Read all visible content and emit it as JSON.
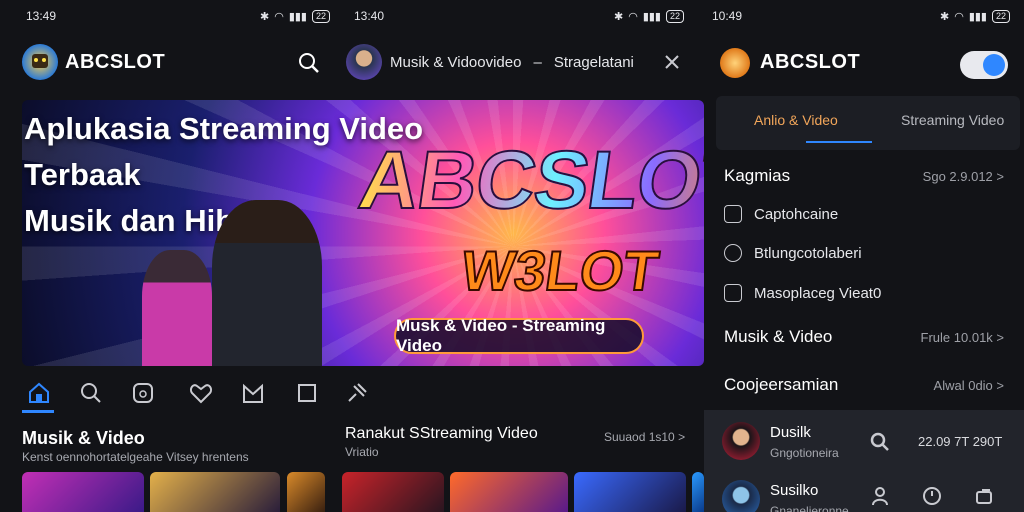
{
  "screen1": {
    "status": {
      "time": "13:49",
      "battery": "22"
    },
    "brand": "ABCSLOT",
    "hero": {
      "title_line1": "Aplukasia Streaming Video Terbaak",
      "title_line2": "Musik dan Hiburan",
      "logo_text": "ABCSLOT",
      "logo_sub": "W3LOT",
      "pill": "Musk & Video - Streaming Video"
    },
    "nav_icons": [
      "home-icon",
      "search-icon",
      "music-icon",
      "heart-icon",
      "mail-icon",
      "square-icon",
      "pin-icon"
    ],
    "section": {
      "title": "Musik & Video",
      "subtitle": "Kenst oennohortatelgeahe Vitsey hrentens"
    }
  },
  "screen2": {
    "status": {
      "time": "13:40",
      "battery": "22"
    },
    "header": {
      "title": "Musik & Vidoovideo",
      "dash": "–",
      "subtitle": "Stragelatani"
    },
    "section": {
      "title": "Ranakut SStreaming Video",
      "subtitle": "Vriatio",
      "see_all": "Suuaod 1s10 >"
    }
  },
  "screen3": {
    "status": {
      "time": "10:49",
      "battery": "22"
    },
    "brand": "ABCSLOT",
    "tabs": {
      "active": "Anlio & Video",
      "inactive": "Streaming Video"
    },
    "menu": [
      {
        "label": "Kagmias",
        "value": "Sgo 2.9.012 >"
      },
      {
        "label": "Musik & Video",
        "value": "Frule 10.01k >"
      },
      {
        "label": "Coojeersamian",
        "value": "Alwal 0dio >"
      }
    ],
    "submenu": [
      "Captohcaine",
      "Btlungcotolaberi",
      "Masoplaceg Vieat0"
    ],
    "list": [
      {
        "title": "Dusilk",
        "subtitle": "Gngotioneira",
        "value": "22.09 7T 290T"
      },
      {
        "title": "Susilko",
        "subtitle": "Gnanelieronne"
      }
    ]
  },
  "colors": {
    "accent": "#2f87ff",
    "tab_active": "#f2a65a",
    "background": "#121317"
  }
}
